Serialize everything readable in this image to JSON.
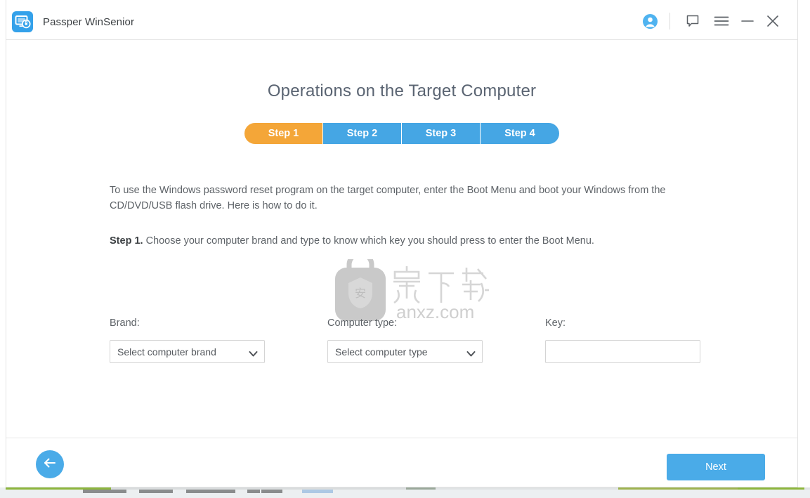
{
  "window": {
    "app_title": "Passper WinSenior",
    "logo_icon": "monitor-key-icon"
  },
  "titlebar": {
    "account_icon": "user-account-icon",
    "feedback_icon": "speech-bubble-icon",
    "menu_icon": "hamburger-menu-icon",
    "minimize_icon": "minimize-icon",
    "close_icon": "close-icon"
  },
  "main": {
    "page_title": "Operations on the Target Computer",
    "steps": [
      {
        "label": "Step 1",
        "active": true
      },
      {
        "label": "Step 2",
        "active": false
      },
      {
        "label": "Step 3",
        "active": false
      },
      {
        "label": "Step 4",
        "active": false
      }
    ],
    "intro_text": "To use the Windows password reset program on the target computer, enter the Boot Menu and boot your Windows from the CD/DVD/USB flash drive. Here is how to do it.",
    "instruction_prefix": "Step 1.",
    "instruction_text": " Choose your computer brand and type to know which key you should press to enter the Boot Menu."
  },
  "form": {
    "brand": {
      "label": "Brand:",
      "selected": "Select computer brand",
      "chevron_icon": "chevron-down-icon"
    },
    "computer_type": {
      "label": "Computer type:",
      "selected": "Select computer type",
      "chevron_icon": "chevron-down-icon"
    },
    "key": {
      "label": "Key:",
      "value": "",
      "placeholder": ""
    }
  },
  "footer": {
    "back_icon": "arrow-left-icon",
    "next_label": "Next"
  },
  "watermark": {
    "site": "anxz.com",
    "chinese_text": "安下载",
    "badge_char": "安"
  },
  "colors": {
    "accent_blue": "#4aabe8",
    "step_blue": "#45a6e4",
    "step_active_orange": "#f4a638",
    "logo_blue": "#34a1ea",
    "text_gray": "#5e6368",
    "title_gray": "#5a6472",
    "border_gray": "#d4d4d4"
  }
}
